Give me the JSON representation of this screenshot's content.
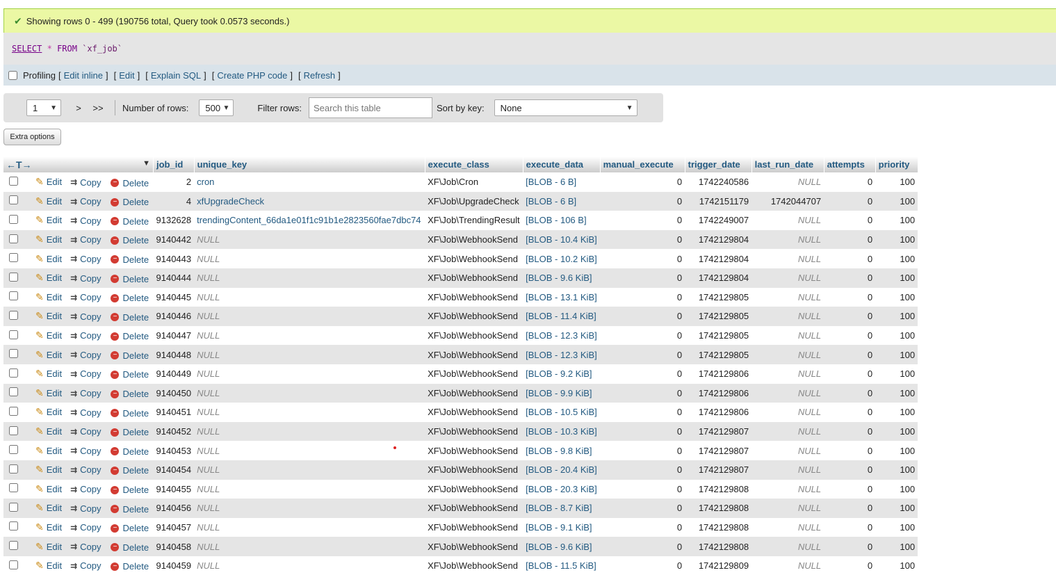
{
  "status": {
    "message": "Showing rows 0 - 499 (190756 total, Query took 0.0573 seconds.)"
  },
  "sql": {
    "kw_select": "SELECT",
    "star": "*",
    "kw_from": "FROM",
    "table": "`xf_job`"
  },
  "links": {
    "profiling": "Profiling",
    "edit_inline": "Edit inline",
    "edit": "Edit",
    "explain": "Explain SQL",
    "php": "Create PHP code",
    "refresh": "Refresh"
  },
  "nav": {
    "page": "1",
    "next": ">",
    "last": ">>",
    "rows_label": "Number of rows:",
    "rows_value": "500",
    "filter_label": "Filter rows:",
    "filter_placeholder": "Search this table",
    "sort_label": "Sort by key:",
    "sort_value": "None"
  },
  "extra_options": "Extra options",
  "actions": {
    "edit": "Edit",
    "copy": "Copy",
    "delete": "Delete"
  },
  "columns": [
    "job_id",
    "unique_key",
    "execute_class",
    "execute_data",
    "manual_execute",
    "trigger_date",
    "last_run_date",
    "attempts",
    "priority"
  ],
  "rows": [
    {
      "job_id": "2",
      "unique_key": "cron",
      "execute_class": "XF\\Job\\Cron",
      "execute_data": "[BLOB - 6 B]",
      "manual_execute": "0",
      "trigger_date": "1742240586",
      "last_run_date": "NULL",
      "attempts": "0",
      "priority": "100"
    },
    {
      "job_id": "4",
      "unique_key": "xfUpgradeCheck",
      "execute_class": "XF\\Job\\UpgradeCheck",
      "execute_data": "[BLOB - 6 B]",
      "manual_execute": "0",
      "trigger_date": "1742151179",
      "last_run_date": "1742044707",
      "attempts": "0",
      "priority": "100"
    },
    {
      "job_id": "9132628",
      "unique_key": "trendingContent_66da1e01f1c91b1e2823560fae7dbc74",
      "execute_class": "XF\\Job\\TrendingResult",
      "execute_data": "[BLOB - 106 B]",
      "manual_execute": "0",
      "trigger_date": "1742249007",
      "last_run_date": "NULL",
      "attempts": "0",
      "priority": "100"
    },
    {
      "job_id": "9140442",
      "unique_key": "NULL",
      "execute_class": "XF\\Job\\WebhookSend",
      "execute_data": "[BLOB - 10.4 KiB]",
      "manual_execute": "0",
      "trigger_date": "1742129804",
      "last_run_date": "NULL",
      "attempts": "0",
      "priority": "100"
    },
    {
      "job_id": "9140443",
      "unique_key": "NULL",
      "execute_class": "XF\\Job\\WebhookSend",
      "execute_data": "[BLOB - 10.2 KiB]",
      "manual_execute": "0",
      "trigger_date": "1742129804",
      "last_run_date": "NULL",
      "attempts": "0",
      "priority": "100"
    },
    {
      "job_id": "9140444",
      "unique_key": "NULL",
      "execute_class": "XF\\Job\\WebhookSend",
      "execute_data": "[BLOB - 9.6 KiB]",
      "manual_execute": "0",
      "trigger_date": "1742129804",
      "last_run_date": "NULL",
      "attempts": "0",
      "priority": "100"
    },
    {
      "job_id": "9140445",
      "unique_key": "NULL",
      "execute_class": "XF\\Job\\WebhookSend",
      "execute_data": "[BLOB - 13.1 KiB]",
      "manual_execute": "0",
      "trigger_date": "1742129805",
      "last_run_date": "NULL",
      "attempts": "0",
      "priority": "100"
    },
    {
      "job_id": "9140446",
      "unique_key": "NULL",
      "execute_class": "XF\\Job\\WebhookSend",
      "execute_data": "[BLOB - 11.4 KiB]",
      "manual_execute": "0",
      "trigger_date": "1742129805",
      "last_run_date": "NULL",
      "attempts": "0",
      "priority": "100"
    },
    {
      "job_id": "9140447",
      "unique_key": "NULL",
      "execute_class": "XF\\Job\\WebhookSend",
      "execute_data": "[BLOB - 12.3 KiB]",
      "manual_execute": "0",
      "trigger_date": "1742129805",
      "last_run_date": "NULL",
      "attempts": "0",
      "priority": "100"
    },
    {
      "job_id": "9140448",
      "unique_key": "NULL",
      "execute_class": "XF\\Job\\WebhookSend",
      "execute_data": "[BLOB - 12.3 KiB]",
      "manual_execute": "0",
      "trigger_date": "1742129805",
      "last_run_date": "NULL",
      "attempts": "0",
      "priority": "100"
    },
    {
      "job_id": "9140449",
      "unique_key": "NULL",
      "execute_class": "XF\\Job\\WebhookSend",
      "execute_data": "[BLOB - 9.2 KiB]",
      "manual_execute": "0",
      "trigger_date": "1742129806",
      "last_run_date": "NULL",
      "attempts": "0",
      "priority": "100"
    },
    {
      "job_id": "9140450",
      "unique_key": "NULL",
      "execute_class": "XF\\Job\\WebhookSend",
      "execute_data": "[BLOB - 9.9 KiB]",
      "manual_execute": "0",
      "trigger_date": "1742129806",
      "last_run_date": "NULL",
      "attempts": "0",
      "priority": "100"
    },
    {
      "job_id": "9140451",
      "unique_key": "NULL",
      "execute_class": "XF\\Job\\WebhookSend",
      "execute_data": "[BLOB - 10.5 KiB]",
      "manual_execute": "0",
      "trigger_date": "1742129806",
      "last_run_date": "NULL",
      "attempts": "0",
      "priority": "100"
    },
    {
      "job_id": "9140452",
      "unique_key": "NULL",
      "execute_class": "XF\\Job\\WebhookSend",
      "execute_data": "[BLOB - 10.3 KiB]",
      "manual_execute": "0",
      "trigger_date": "1742129807",
      "last_run_date": "NULL",
      "attempts": "0",
      "priority": "100"
    },
    {
      "job_id": "9140453",
      "unique_key": "NULL",
      "execute_class": "XF\\Job\\WebhookSend",
      "execute_data": "[BLOB - 9.8 KiB]",
      "manual_execute": "0",
      "trigger_date": "1742129807",
      "last_run_date": "NULL",
      "attempts": "0",
      "priority": "100"
    },
    {
      "job_id": "9140454",
      "unique_key": "NULL",
      "execute_class": "XF\\Job\\WebhookSend",
      "execute_data": "[BLOB - 20.4 KiB]",
      "manual_execute": "0",
      "trigger_date": "1742129807",
      "last_run_date": "NULL",
      "attempts": "0",
      "priority": "100"
    },
    {
      "job_id": "9140455",
      "unique_key": "NULL",
      "execute_class": "XF\\Job\\WebhookSend",
      "execute_data": "[BLOB - 20.3 KiB]",
      "manual_execute": "0",
      "trigger_date": "1742129808",
      "last_run_date": "NULL",
      "attempts": "0",
      "priority": "100"
    },
    {
      "job_id": "9140456",
      "unique_key": "NULL",
      "execute_class": "XF\\Job\\WebhookSend",
      "execute_data": "[BLOB - 8.7 KiB]",
      "manual_execute": "0",
      "trigger_date": "1742129808",
      "last_run_date": "NULL",
      "attempts": "0",
      "priority": "100"
    },
    {
      "job_id": "9140457",
      "unique_key": "NULL",
      "execute_class": "XF\\Job\\WebhookSend",
      "execute_data": "[BLOB - 9.1 KiB]",
      "manual_execute": "0",
      "trigger_date": "1742129808",
      "last_run_date": "NULL",
      "attempts": "0",
      "priority": "100"
    },
    {
      "job_id": "9140458",
      "unique_key": "NULL",
      "execute_class": "XF\\Job\\WebhookSend",
      "execute_data": "[BLOB - 9.6 KiB]",
      "manual_execute": "0",
      "trigger_date": "1742129808",
      "last_run_date": "NULL",
      "attempts": "0",
      "priority": "100"
    },
    {
      "job_id": "9140459",
      "unique_key": "NULL",
      "execute_class": "XF\\Job\\WebhookSend",
      "execute_data": "[BLOB - 11.5 KiB]",
      "manual_execute": "0",
      "trigger_date": "1742129809",
      "last_run_date": "NULL",
      "attempts": "0",
      "priority": "100"
    }
  ]
}
